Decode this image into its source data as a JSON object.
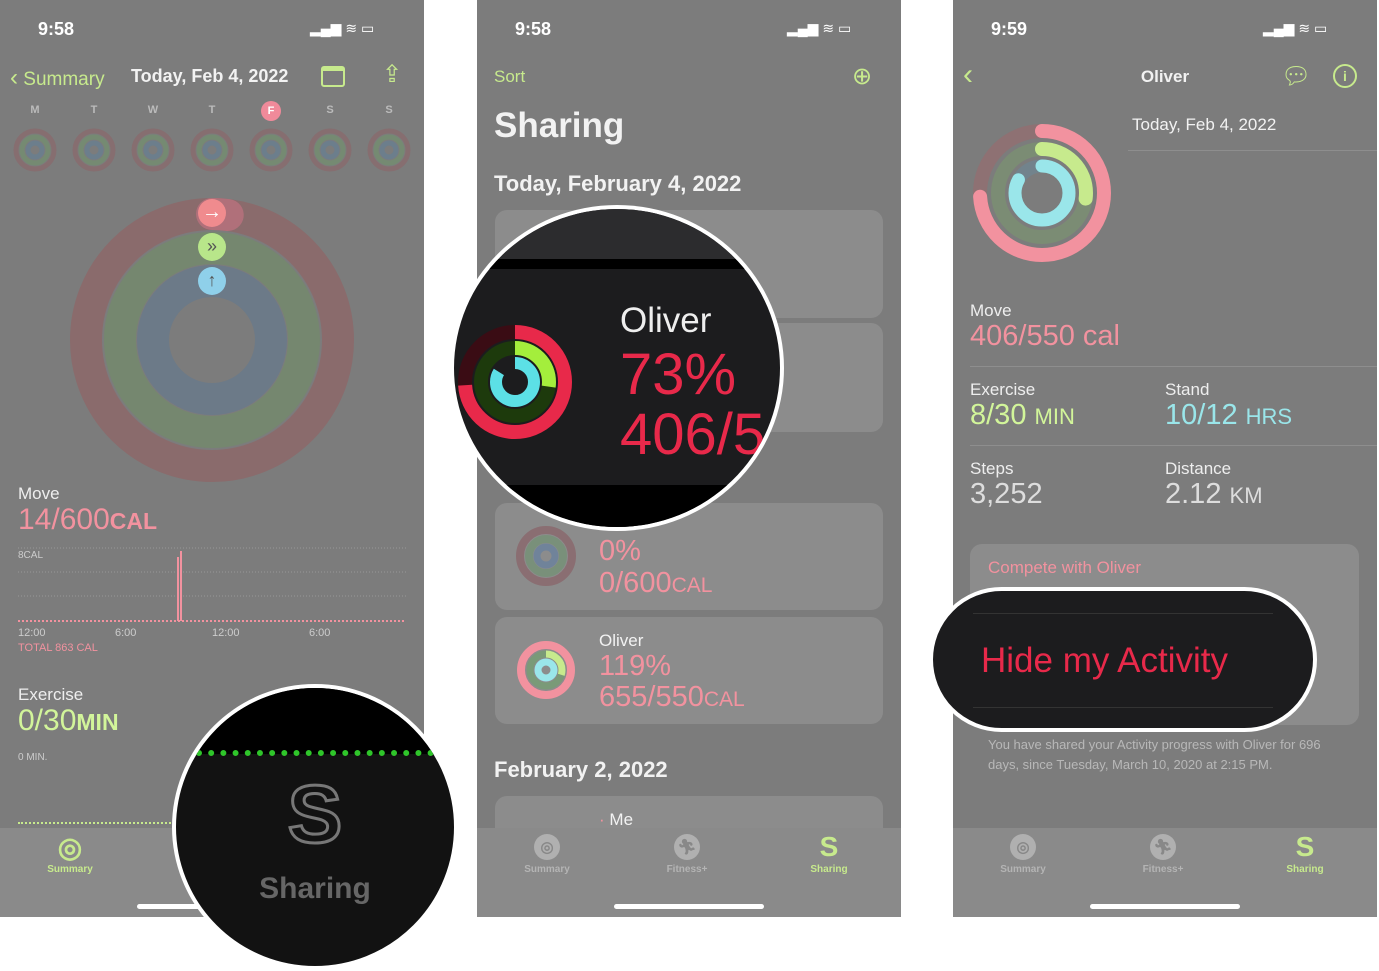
{
  "colors": {
    "accent_green": "#c7ea8d",
    "move_pink": "#f2929f",
    "stand_cyan": "#9ae6ea",
    "mag_red": "#e8294a"
  },
  "panel1": {
    "status": {
      "time": "9:58"
    },
    "nav": {
      "back_label": "Summary",
      "title": "Today, Feb 4, 2022",
      "calendar_icon": "calendar-icon",
      "share_icon": "share-icon"
    },
    "week": [
      {
        "d": "M"
      },
      {
        "d": "T"
      },
      {
        "d": "W"
      },
      {
        "d": "T"
      },
      {
        "d": "F",
        "selected": true
      },
      {
        "d": "S"
      },
      {
        "d": "S"
      }
    ],
    "rings": {
      "move": 0.02,
      "exercise": 0,
      "stand": 0
    },
    "move": {
      "label": "Move",
      "value": "14/600",
      "unit": "CAL",
      "chart_max": "8CAL",
      "ticks": [
        "12:00",
        "6:00",
        "12:00",
        "6:00"
      ],
      "total": "TOTAL 863 CAL"
    },
    "exercise": {
      "label": "Exercise",
      "value": "0/30",
      "unit": "MIN",
      "axis": "0 MIN."
    },
    "tabs": [
      {
        "label": "Summary"
      }
    ],
    "magnifier": {
      "label": "Sharing"
    }
  },
  "panel2": {
    "status": {
      "time": "9:58"
    },
    "nav": {
      "sort_label": "Sort",
      "add_icon": "person-add-icon"
    },
    "title": "Sharing",
    "section1": "Today, February 4, 2022",
    "cards": [
      {
        "name": "",
        "percent": "0%",
        "value": "0/600",
        "unit": "CAL",
        "ring": 0
      },
      {
        "name": "Oliver",
        "percent": "119%",
        "value": "655/550",
        "unit": "CAL",
        "ring": 1
      }
    ],
    "section2": "February 2, 2022",
    "card_me": "Me",
    "tabs": [
      {
        "label": "Summary"
      },
      {
        "label": "Fitness+"
      },
      {
        "label": "Sharing"
      }
    ],
    "magnifier": {
      "name": "Oliver",
      "percent": "73%",
      "value": "406/5"
    }
  },
  "panel3": {
    "status": {
      "time": "9:59"
    },
    "nav": {
      "title": "Oliver",
      "chat_icon": "message-icon",
      "info_icon": "info-icon"
    },
    "date": "Today, Feb 4, 2022",
    "rings": {
      "move": 0.74,
      "exercise": 0.27,
      "stand": 0.83
    },
    "move": {
      "label": "Move",
      "value": "406/550 cal"
    },
    "exercise": {
      "label": "Exercise",
      "value": "8/30",
      "unit": "MIN"
    },
    "stand": {
      "label": "Stand",
      "value": "10/12",
      "unit": "HRS"
    },
    "steps": {
      "label": "Steps",
      "value": "3,252"
    },
    "distance": {
      "label": "Distance",
      "value": "2.12",
      "unit": "KM"
    },
    "compete": "Compete with Oliver",
    "hide": "Hide my Activity",
    "footer": "You have shared your Activity progress with Oliver for 696 days, since Tuesday, March 10, 2020 at 2:15 PM.",
    "tabs": [
      {
        "label": "Summary"
      },
      {
        "label": "Fitness+"
      },
      {
        "label": "Sharing"
      }
    ]
  }
}
